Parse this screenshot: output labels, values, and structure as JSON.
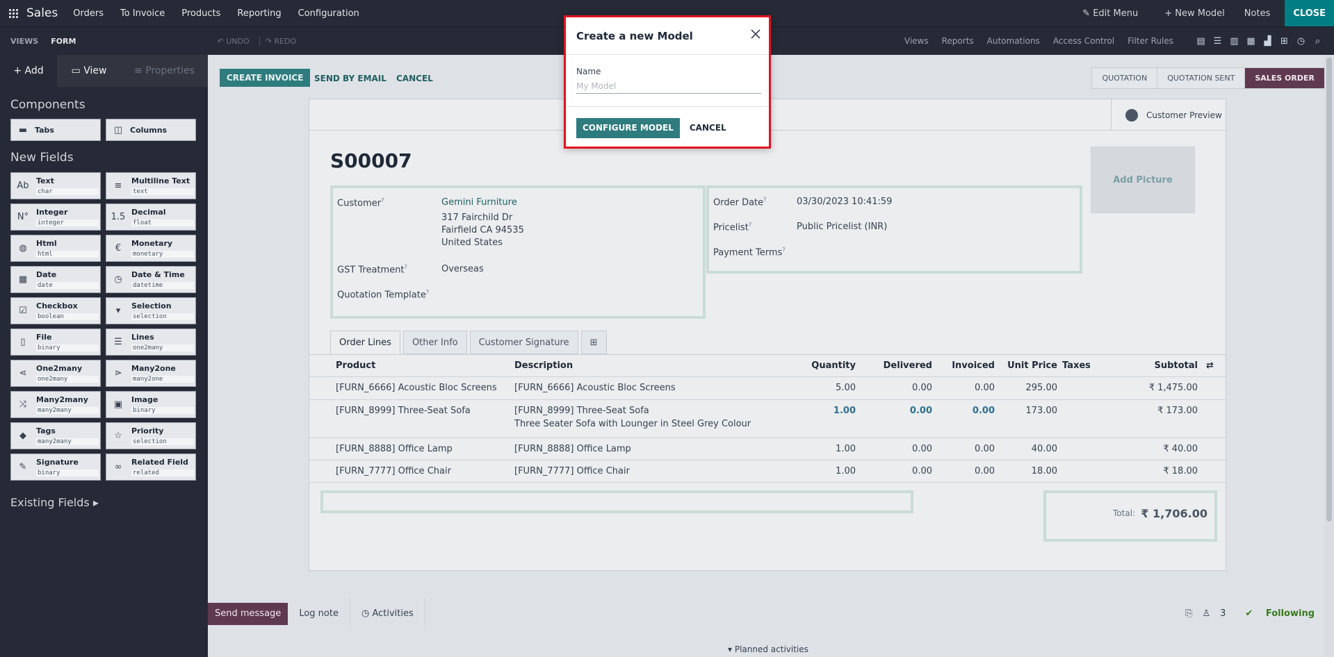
{
  "topbar": {
    "brand": "Sales",
    "menu": [
      "Orders",
      "To Invoice",
      "Products",
      "Reporting",
      "Configuration"
    ],
    "edit_menu": "Edit Menu",
    "new_model": "New Model",
    "notes": "Notes",
    "close": "CLOSE"
  },
  "subbar": {
    "views_tab": "VIEWS",
    "form_tab": "FORM",
    "undo": "UNDO",
    "redo": "REDO",
    "links": [
      "Views",
      "Reports",
      "Automations",
      "Access Control",
      "Filter Rules"
    ]
  },
  "sidebar": {
    "tabs": {
      "add": "Add",
      "view": "View",
      "properties": "Properties"
    },
    "components_heading": "Components",
    "components": [
      {
        "name": "Tabs",
        "icon": "tabs-icon"
      },
      {
        "name": "Columns",
        "icon": "columns-icon"
      }
    ],
    "new_fields_heading": "New Fields",
    "fields": [
      {
        "name": "Text",
        "type": "char",
        "glyph": "Ab"
      },
      {
        "name": "Multiline Text",
        "type": "text",
        "glyph": "≡"
      },
      {
        "name": "Integer",
        "type": "integer",
        "glyph": "N°"
      },
      {
        "name": "Decimal",
        "type": "float",
        "glyph": "1.5"
      },
      {
        "name": "Html",
        "type": "html",
        "glyph": "◍"
      },
      {
        "name": "Monetary",
        "type": "monetary",
        "glyph": "€"
      },
      {
        "name": "Date",
        "type": "date",
        "glyph": "▦"
      },
      {
        "name": "Date & Time",
        "type": "datetime",
        "glyph": "◷"
      },
      {
        "name": "Checkbox",
        "type": "boolean",
        "glyph": "☑"
      },
      {
        "name": "Selection",
        "type": "selection",
        "glyph": "▾"
      },
      {
        "name": "File",
        "type": "binary",
        "glyph": "▯"
      },
      {
        "name": "Lines",
        "type": "one2many",
        "glyph": "☰"
      },
      {
        "name": "One2many",
        "type": "one2many",
        "glyph": "⋖"
      },
      {
        "name": "Many2one",
        "type": "many2one",
        "glyph": "⋗"
      },
      {
        "name": "Many2many",
        "type": "many2many",
        "glyph": "⤨"
      },
      {
        "name": "Image",
        "type": "binary",
        "glyph": "▣"
      },
      {
        "name": "Tags",
        "type": "many2many",
        "glyph": "◆"
      },
      {
        "name": "Priority",
        "type": "selection",
        "glyph": "☆"
      },
      {
        "name": "Signature",
        "type": "binary",
        "glyph": "✎"
      },
      {
        "name": "Related Field",
        "type": "related",
        "glyph": "∞"
      }
    ],
    "existing_fields": "Existing Fields"
  },
  "control": {
    "create_invoice": "CREATE INVOICE",
    "send_by_email": "SEND BY EMAIL",
    "cancel": "CANCEL",
    "statuses": [
      "QUOTATION",
      "QUOTATION SENT",
      "SALES ORDER"
    ]
  },
  "form": {
    "preview": "Customer Preview",
    "title": "S00007",
    "add_picture": "Add Picture",
    "customer_label": "Customer",
    "customer_name": "Gemini Furniture",
    "address1": "317 Fairchild Dr",
    "address2": "Fairfield CA 94535",
    "address3": "United States",
    "gst_label": "GST Treatment",
    "gst_value": "Overseas",
    "qt_label": "Quotation Template",
    "order_date_label": "Order Date",
    "order_date_value": "03/30/2023 10:41:59",
    "pricelist_label": "Pricelist",
    "pricelist_value": "Public Pricelist (INR)",
    "payment_terms_label": "Payment Terms",
    "tabs": [
      "Order Lines",
      "Other Info",
      "Customer Signature"
    ],
    "columns": {
      "product": "Product",
      "description": "Description",
      "quantity": "Quantity",
      "delivered": "Delivered",
      "invoiced": "Invoiced",
      "unit_price": "Unit Price",
      "taxes": "Taxes",
      "subtotal": "Subtotal"
    },
    "lines": [
      {
        "product": "[FURN_6666] Acoustic Bloc Screens",
        "description": "[FURN_6666] Acoustic Bloc Screens",
        "description2": "",
        "quantity": "5.00",
        "delivered": "0.00",
        "invoiced": "0.00",
        "unit_price": "295.00",
        "subtotal": "₹ 1,475.00"
      },
      {
        "product": "[FURN_8999] Three-Seat Sofa",
        "description": "[FURN_8999] Three-Seat Sofa",
        "description2": "Three Seater Sofa with Lounger in Steel Grey Colour",
        "quantity": "1.00",
        "delivered": "0.00",
        "invoiced": "0.00",
        "unit_price": "173.00",
        "subtotal": "₹ 173.00"
      },
      {
        "product": "[FURN_8888] Office Lamp",
        "description": "[FURN_8888] Office Lamp",
        "description2": "",
        "quantity": "1.00",
        "delivered": "0.00",
        "invoiced": "0.00",
        "unit_price": "40.00",
        "subtotal": "₹ 40.00"
      },
      {
        "product": "[FURN_7777] Office Chair",
        "description": "[FURN_7777] Office Chair",
        "description2": "",
        "quantity": "1.00",
        "delivered": "0.00",
        "invoiced": "0.00",
        "unit_price": "18.00",
        "subtotal": "₹ 18.00"
      }
    ],
    "total_label": "Total:",
    "total_value": "₹ 1,706.00"
  },
  "chatter": {
    "send_message": "Send message",
    "log_note": "Log note",
    "activities": "Activities",
    "followers": "3",
    "following": "Following",
    "planned": "Planned activities"
  },
  "modal": {
    "title": "Create a new Model",
    "name_label": "Name",
    "name_value": "",
    "name_placeholder": "My Model",
    "configure": "CONFIGURE MODEL",
    "cancel": "CANCEL"
  }
}
